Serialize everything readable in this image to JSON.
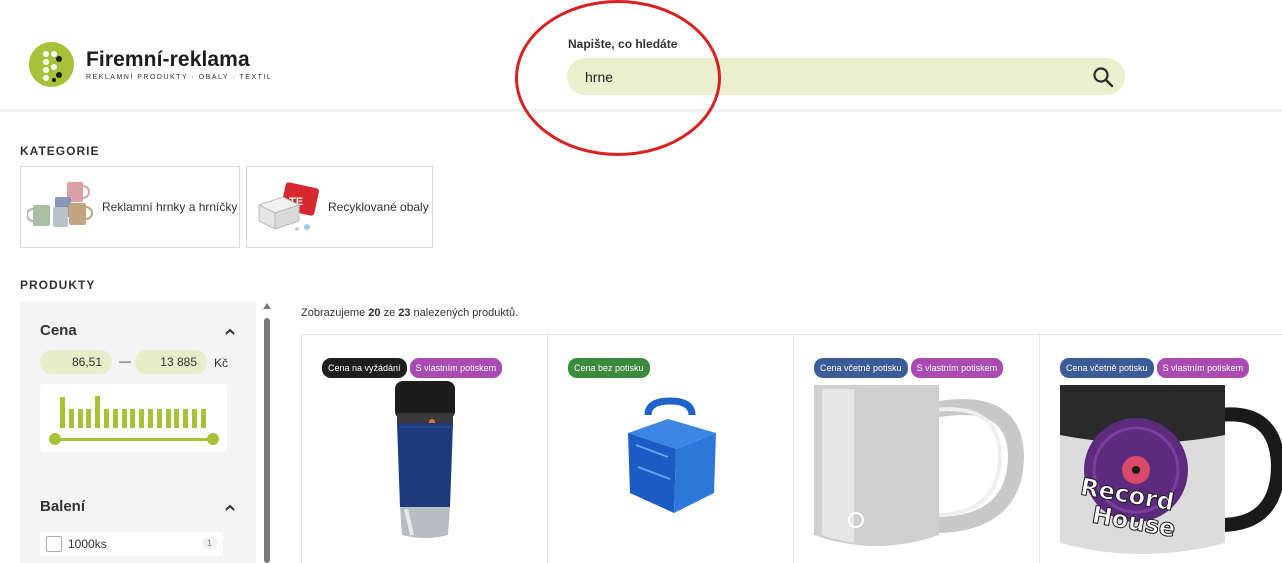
{
  "header": {
    "logo_title": "Firemní-reklama",
    "logo_subtitle": "REKLAMNÍ PRODUKTY · OBALY · TEXTIL",
    "search_label": "Napište, co hledáte",
    "search_value": "hrne"
  },
  "categories": {
    "title": "KATEGORIE",
    "items": [
      {
        "label": "Reklamní hrnky a hrníčky"
      },
      {
        "label": "Recyklované obaly"
      }
    ]
  },
  "products_section": {
    "title": "PRODUKTY"
  },
  "filters": {
    "price": {
      "title": "Cena",
      "min": "86,51",
      "separator": "—",
      "max": "13 885",
      "unit": "Kč",
      "histogram": [
        0.9,
        0.55,
        0.55,
        0.55,
        0.95,
        0.55,
        0.55,
        0.55,
        0.55,
        0.55,
        0.55,
        0.55,
        0.55,
        0.55,
        0.55,
        0.55,
        0.55
      ],
      "range": [
        0,
        1
      ]
    },
    "packaging": {
      "title": "Balení",
      "options": [
        {
          "label": "1000ks",
          "count": "1",
          "checked": false
        }
      ]
    }
  },
  "results": {
    "prefix": "Zobrazujeme ",
    "shown": "20",
    "middle": " ze ",
    "total": "23",
    "suffix": " nalezených produktů."
  },
  "product_cards": [
    {
      "badges": [
        {
          "label": "Cena na vyžádání",
          "color": "black"
        },
        {
          "label": "S vlastním potiskem",
          "color": "purple"
        }
      ],
      "image": "travel-mug"
    },
    {
      "badges": [
        {
          "label": "Cena bez potisku",
          "color": "green"
        }
      ],
      "image": "blue-gift-box"
    },
    {
      "badges": [
        {
          "label": "Cena včetně potisku",
          "color": "blue"
        },
        {
          "label": "S vlastním potiskem",
          "color": "purple"
        }
      ],
      "image": "silver-mug"
    },
    {
      "badges": [
        {
          "label": "Cena včetně potisku",
          "color": "blue"
        },
        {
          "label": "S vlastním potiskem",
          "color": "purple"
        }
      ],
      "image": "record-house-mug"
    }
  ],
  "colors": {
    "accent": "#a6c13a",
    "search_bg": "#eaf0ce",
    "annotation": "#d92121"
  }
}
